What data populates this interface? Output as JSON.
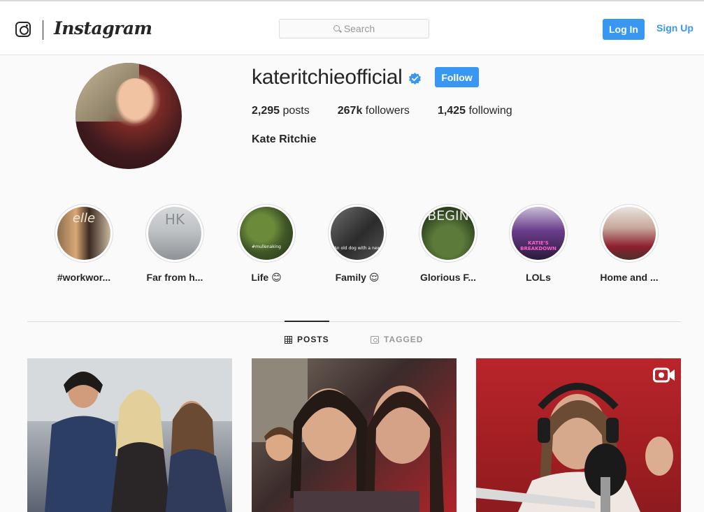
{
  "header": {
    "wordmark": "Instagram",
    "search_placeholder": "Search",
    "login_label": "Log In",
    "signup_label": "Sign Up"
  },
  "profile": {
    "username": "kateritchieofficial",
    "verified": true,
    "follow_label": "Follow",
    "stats": {
      "posts_count": "2,295",
      "posts_label": "posts",
      "followers_count": "267k",
      "followers_label": "followers",
      "following_count": "1,425",
      "following_label": "following"
    },
    "full_name": "Kate Ritchie"
  },
  "highlights": [
    {
      "label": "#workwor...",
      "cover_text": "elle"
    },
    {
      "label": "Far from h...",
      "cover_text": "HK"
    },
    {
      "label": "Life 😊",
      "cover_text": "#mullenaking"
    },
    {
      "label": "Family 😌",
      "cover_text": "An old dog with a new"
    },
    {
      "label": "Glorious F...",
      "cover_text": "BEGIN"
    },
    {
      "label": "LOLs",
      "cover_text": "KATIE'S BREAKDOWN"
    },
    {
      "label": "Home and ...",
      "cover_text": ""
    }
  ],
  "tabs": {
    "posts_label": "POSTS",
    "tagged_label": "TAGGED"
  },
  "posts": [
    {
      "type": "photo"
    },
    {
      "type": "photo"
    },
    {
      "type": "video"
    }
  ],
  "colors": {
    "accent": "#3897f0",
    "text": "#262626",
    "muted": "#999999",
    "background": "#fafafa",
    "border": "#dbdbdb"
  }
}
